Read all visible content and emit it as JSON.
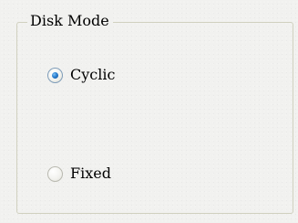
{
  "group": {
    "title": "Disk Mode"
  },
  "options": [
    {
      "label": "Cyclic",
      "checked": true
    },
    {
      "label": "Fixed",
      "checked": false
    }
  ],
  "colors": {
    "panel_background": "#f1f1ef",
    "group_border": "#d0d0bf",
    "radio_border": "#7f9db9",
    "radio_dot": "#2a7fcf",
    "text": "#000000"
  }
}
